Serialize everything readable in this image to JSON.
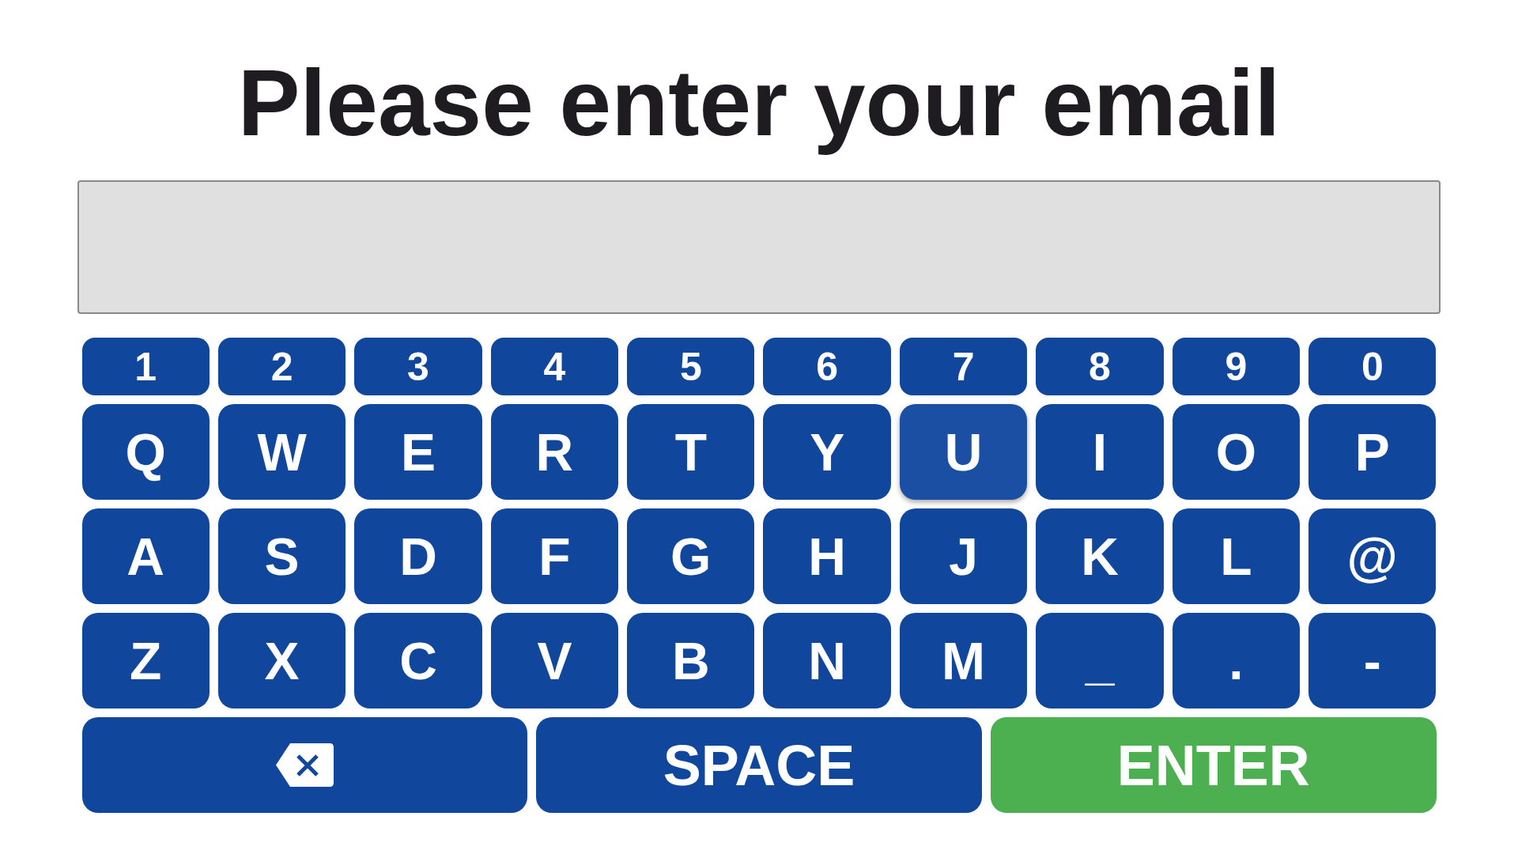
{
  "title": "Please enter your email",
  "keyboard": {
    "rows": [
      {
        "kind": "digits",
        "keys": [
          {
            "kind": "char",
            "label": "1",
            "highlighted": false
          },
          {
            "kind": "char",
            "label": "2",
            "highlighted": false
          },
          {
            "kind": "char",
            "label": "3",
            "highlighted": false
          },
          {
            "kind": "char",
            "label": "4",
            "highlighted": false
          },
          {
            "kind": "char",
            "label": "5",
            "highlighted": false
          },
          {
            "kind": "char",
            "label": "6",
            "highlighted": false
          },
          {
            "kind": "char",
            "label": "7",
            "highlighted": false
          },
          {
            "kind": "char",
            "label": "8",
            "highlighted": false
          },
          {
            "kind": "char",
            "label": "9",
            "highlighted": false
          },
          {
            "kind": "char",
            "label": "0",
            "highlighted": false
          }
        ]
      },
      {
        "kind": "letters",
        "keys": [
          {
            "kind": "char",
            "label": "Q",
            "highlighted": false
          },
          {
            "kind": "char",
            "label": "W",
            "highlighted": false
          },
          {
            "kind": "char",
            "label": "E",
            "highlighted": false
          },
          {
            "kind": "char",
            "label": "R",
            "highlighted": false
          },
          {
            "kind": "char",
            "label": "T",
            "highlighted": false
          },
          {
            "kind": "char",
            "label": "Y",
            "highlighted": false
          },
          {
            "kind": "char",
            "label": "U",
            "highlighted": true
          },
          {
            "kind": "char",
            "label": "I",
            "highlighted": false
          },
          {
            "kind": "char",
            "label": "O",
            "highlighted": false
          },
          {
            "kind": "char",
            "label": "P",
            "highlighted": false
          }
        ]
      },
      {
        "kind": "letters",
        "keys": [
          {
            "kind": "char",
            "label": "A",
            "highlighted": false
          },
          {
            "kind": "char",
            "label": "S",
            "highlighted": false
          },
          {
            "kind": "char",
            "label": "D",
            "highlighted": false
          },
          {
            "kind": "char",
            "label": "F",
            "highlighted": false
          },
          {
            "kind": "char",
            "label": "G",
            "highlighted": false
          },
          {
            "kind": "char",
            "label": "H",
            "highlighted": false
          },
          {
            "kind": "char",
            "label": "J",
            "highlighted": false
          },
          {
            "kind": "char",
            "label": "K",
            "highlighted": false
          },
          {
            "kind": "char",
            "label": "L",
            "highlighted": false
          },
          {
            "kind": "char",
            "label": "@",
            "highlighted": false
          }
        ]
      },
      {
        "kind": "letters",
        "keys": [
          {
            "kind": "char",
            "label": "Z",
            "highlighted": false
          },
          {
            "kind": "char",
            "label": "X",
            "highlighted": false
          },
          {
            "kind": "char",
            "label": "C",
            "highlighted": false
          },
          {
            "kind": "char",
            "label": "V",
            "highlighted": false
          },
          {
            "kind": "char",
            "label": "B",
            "highlighted": false
          },
          {
            "kind": "char",
            "label": "N",
            "highlighted": false
          },
          {
            "kind": "char",
            "label": "M",
            "highlighted": false
          },
          {
            "kind": "char",
            "label": "_",
            "highlighted": false
          },
          {
            "kind": "char",
            "label": ".",
            "highlighted": false
          },
          {
            "kind": "char",
            "label": "-",
            "highlighted": false
          }
        ]
      },
      {
        "kind": "actions",
        "keys": [
          {
            "kind": "backspace",
            "highlighted": false
          },
          {
            "kind": "space",
            "label": "SPACE",
            "highlighted": false
          },
          {
            "kind": "enter",
            "label": "ENTER",
            "highlighted": false
          }
        ]
      }
    ]
  }
}
